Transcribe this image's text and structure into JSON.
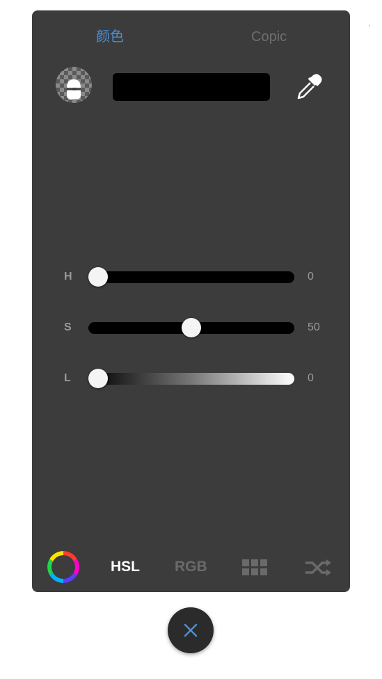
{
  "tabs": {
    "color": "颜色",
    "copic": "Copic"
  },
  "current_color": "#000000",
  "accent_color": "#4a90d9",
  "sliders": [
    {
      "label": "H",
      "value": "0",
      "fraction": 0.0
    },
    {
      "label": "S",
      "value": "50",
      "fraction": 0.5
    },
    {
      "label": "L",
      "value": "0",
      "fraction": 0.0
    }
  ],
  "modes": {
    "hsl": "HSL",
    "rgb": "RGB",
    "active": "HSL"
  },
  "icons": {
    "layer": "layer-transparency-icon",
    "eyedropper": "eyedropper-icon",
    "wheel": "color-wheel-icon",
    "palette": "palette-grid-icon",
    "random": "shuffle-icon",
    "close": "close-icon"
  }
}
